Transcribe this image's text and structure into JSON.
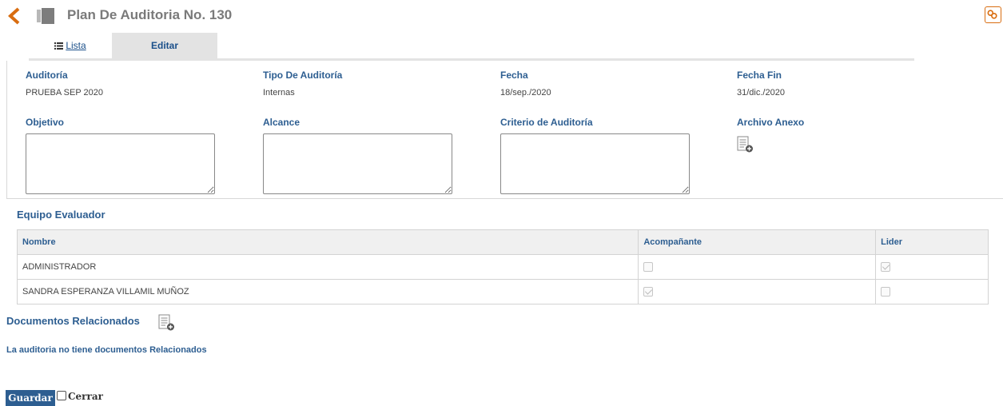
{
  "header": {
    "title": "Plan De Auditoria No. 130",
    "accent_color": "#d96d10",
    "back_icon": "chevron-left-icon",
    "doc_icon": "document-icon",
    "link_icon": "link-icon"
  },
  "tabs": [
    {
      "label": "Lista",
      "icon": "list-icon"
    },
    {
      "label": "Editar"
    }
  ],
  "form": {
    "auditoria": {
      "label": "Auditoría",
      "value": "PRUEBA SEP 2020"
    },
    "tipo": {
      "label": "Tipo De Auditoría",
      "value": "Internas"
    },
    "fecha": {
      "label": "Fecha",
      "value": "18/sep./2020"
    },
    "fecha_fin": {
      "label": "Fecha Fin",
      "value": "31/dic./2020"
    },
    "objetivo": {
      "label": "Objetivo",
      "value": ""
    },
    "alcance": {
      "label": "Alcance",
      "value": ""
    },
    "criterio": {
      "label": "Criterio de Auditoría",
      "value": ""
    },
    "archivo": {
      "label": "Archivo Anexo",
      "icon": "attach-file-icon"
    }
  },
  "equipo": {
    "title": "Equipo Evaluador",
    "columns": [
      "Nombre",
      "Acompañante",
      "Lider"
    ],
    "rows": [
      {
        "nombre": "ADMINISTRADOR",
        "acompanante": false,
        "lider": true
      },
      {
        "nombre": "SANDRA ESPERANZA VILLAMIL MUÑOZ",
        "acompanante": true,
        "lider": false
      }
    ]
  },
  "documentos": {
    "title": "Documentos Relacionados",
    "empty_text": "La auditoria no tiene documentos Relacionados"
  },
  "actions": {
    "save_label": "Guardar",
    "close_label": "Cerrar",
    "close_checked": false,
    "primary_color": "#2d5e91"
  }
}
